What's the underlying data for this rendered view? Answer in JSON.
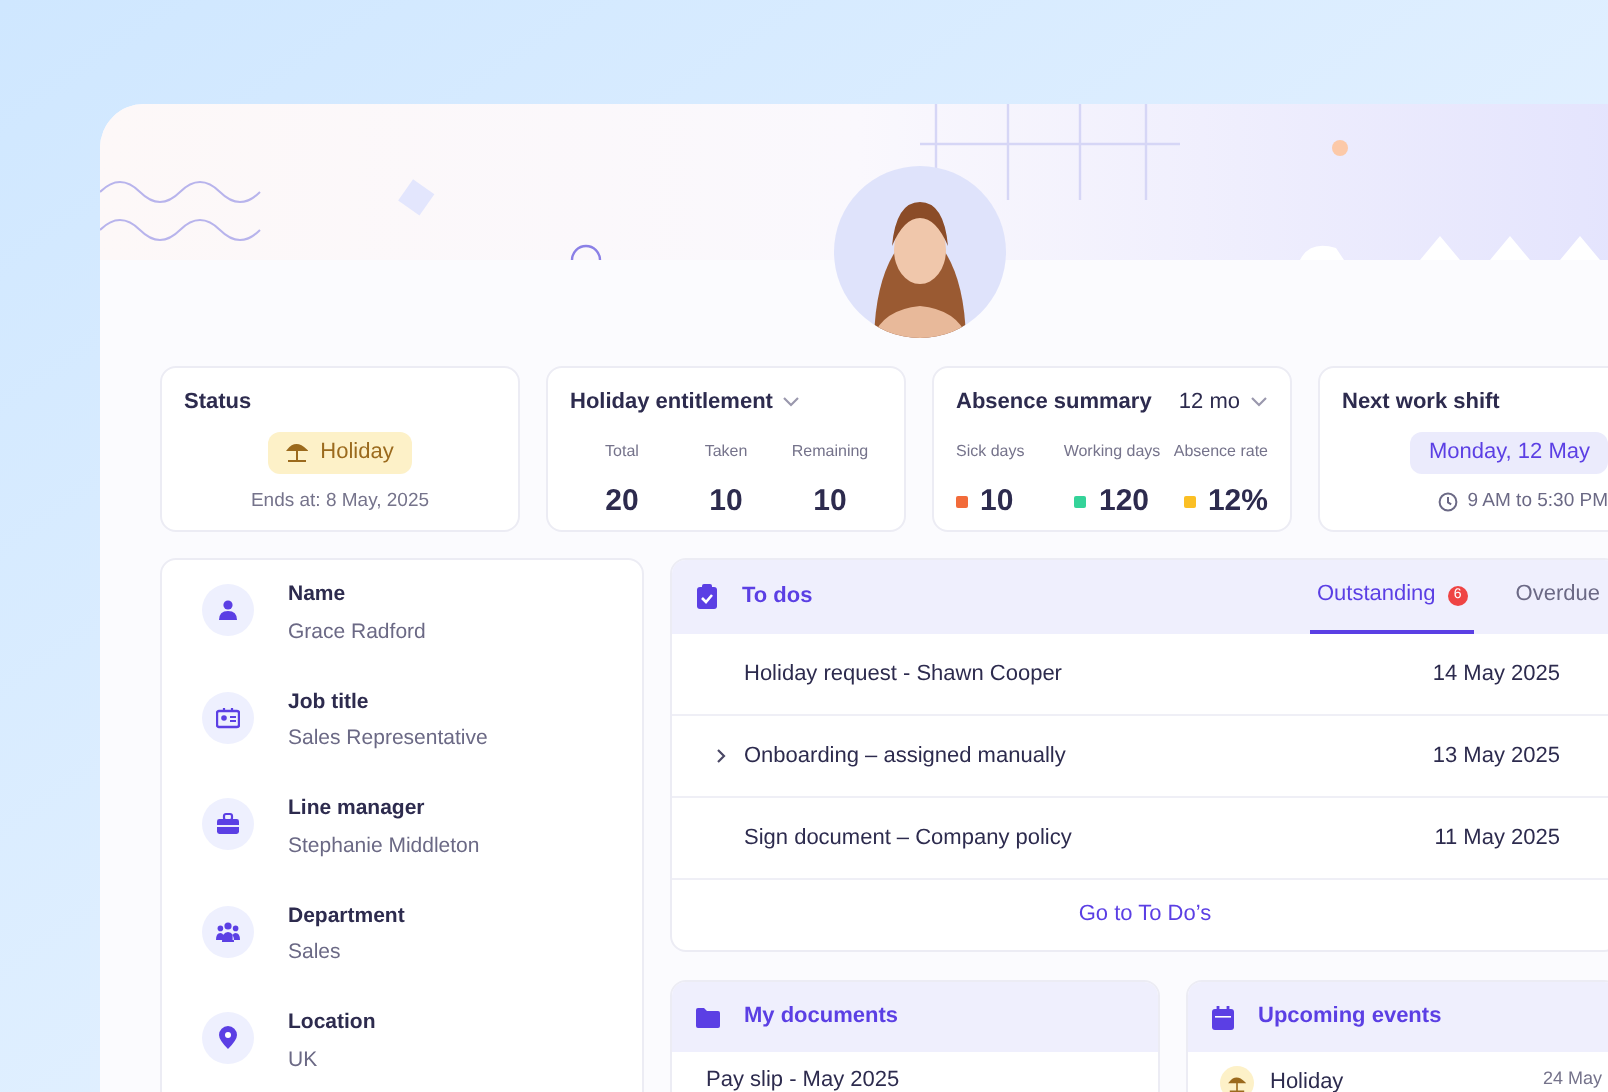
{
  "status_card": {
    "title": "Status",
    "badge": "Holiday",
    "ends": "Ends at: 8 May, 2025"
  },
  "holiday_entitlement": {
    "title": "Holiday entitlement",
    "stats": [
      {
        "label": "Total",
        "value": "20"
      },
      {
        "label": "Taken",
        "value": "10"
      },
      {
        "label": "Remaining",
        "value": "10"
      }
    ]
  },
  "absence_summary": {
    "title": "Absence summary",
    "period": "12 mo",
    "stats": [
      {
        "label": "Sick days",
        "value": "10",
        "color": "#f26b3a"
      },
      {
        "label": "Working days",
        "value": "120",
        "color": "#34d399"
      },
      {
        "label": "Absence rate",
        "value": "12%",
        "color": "#fbbf24"
      }
    ]
  },
  "next_work_shift": {
    "title": "Next work shift",
    "date": "Monday, 12 May",
    "time": "9 AM to 5:30 PM"
  },
  "details": [
    {
      "kind": "person",
      "label": "Name",
      "value": "Grace Radford"
    },
    {
      "kind": "badge",
      "label": "Job title",
      "value": "Sales Representative"
    },
    {
      "kind": "briefcase",
      "label": "Line manager",
      "value": "Stephanie Middleton"
    },
    {
      "kind": "team",
      "label": "Department",
      "value": "Sales"
    },
    {
      "kind": "pin",
      "label": "Location",
      "value": "UK"
    }
  ],
  "todos": {
    "title": "To dos",
    "tabs": [
      {
        "label": "Outstanding",
        "count": "6",
        "selected": true
      },
      {
        "label": "Overdue",
        "selected": false
      }
    ],
    "items": [
      {
        "text": "Holiday request - Shawn Cooper",
        "date": "14 May 2025",
        "expandable": false
      },
      {
        "text": "Onboarding – assigned manually",
        "date": "13 May 2025",
        "expandable": true
      },
      {
        "text": "Sign document – Company policy",
        "date": "11 May 2025",
        "expandable": false
      }
    ],
    "link": "Go to To Do’s"
  },
  "documents": {
    "title": "My documents",
    "items": [
      "Pay slip - May 2025"
    ]
  },
  "events": {
    "title": "Upcoming events",
    "items": [
      {
        "title": "Holiday",
        "date": "24 May"
      }
    ]
  }
}
